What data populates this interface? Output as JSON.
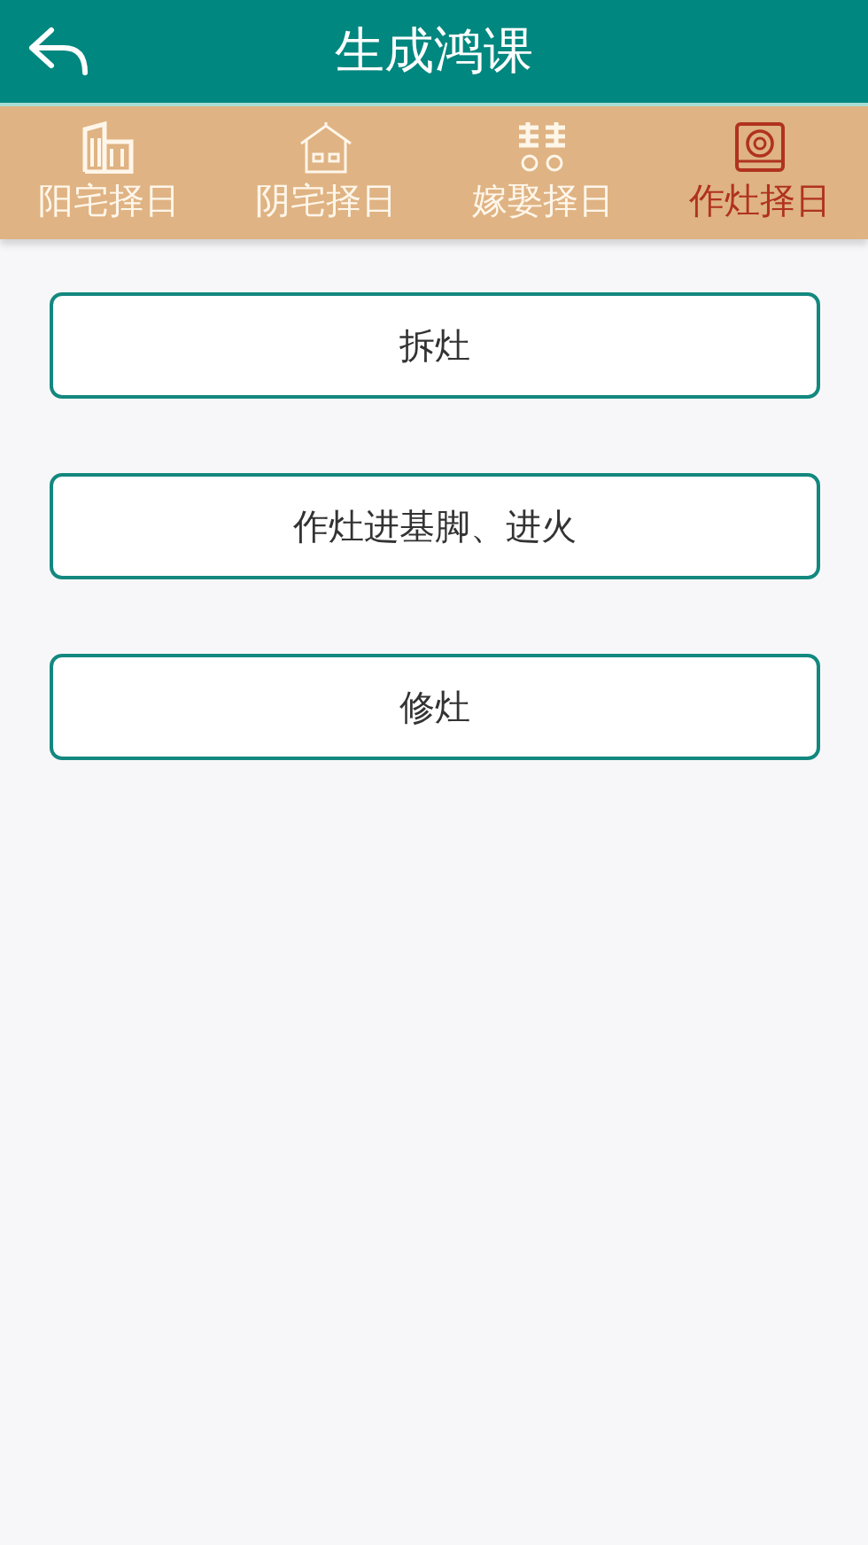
{
  "header": {
    "title": "生成鸿课"
  },
  "tabs": [
    {
      "label": "阳宅择日",
      "selected": false
    },
    {
      "label": "阴宅择日",
      "selected": false
    },
    {
      "label": "嫁娶择日",
      "selected": false
    },
    {
      "label": "作灶择日",
      "selected": true
    }
  ],
  "options": [
    "拆灶",
    "作灶进基脚、进火",
    "修灶"
  ]
}
